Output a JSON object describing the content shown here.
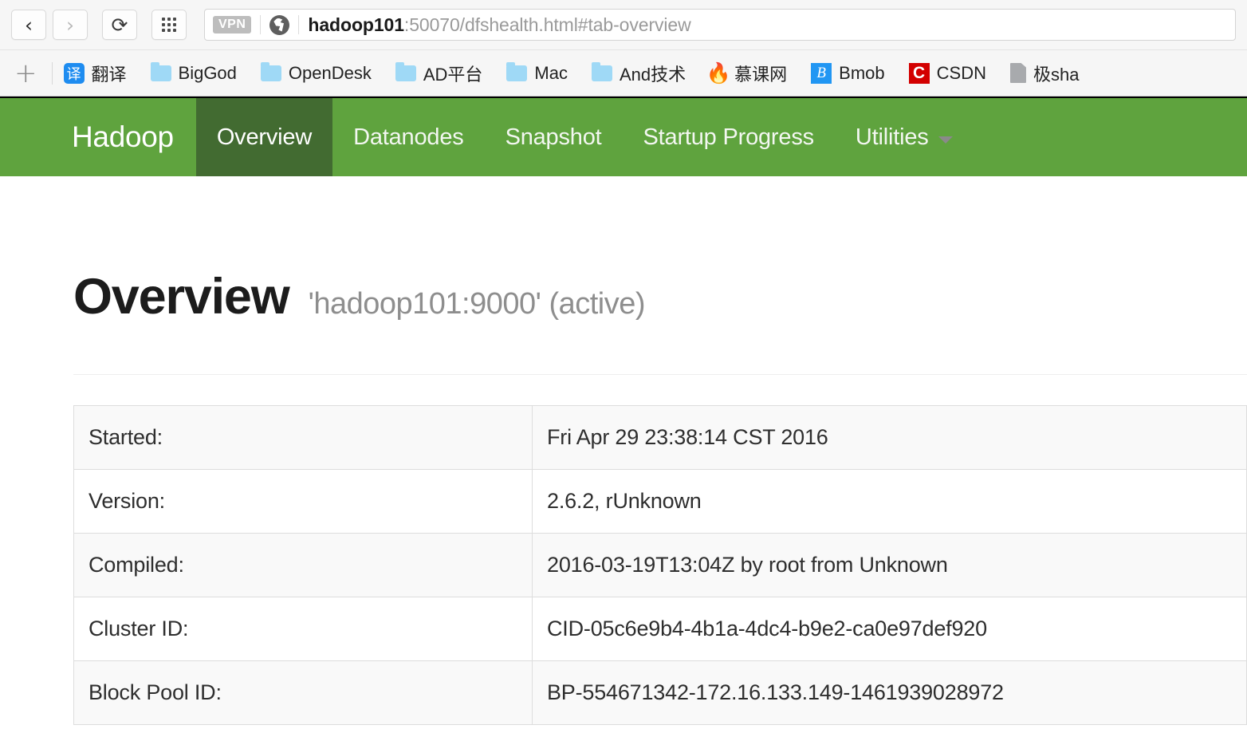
{
  "browser": {
    "back_icon": "chevron-left-icon",
    "forward_icon": "chevron-right-icon",
    "reload_icon": "reload-icon",
    "apps_icon": "apps-grid-icon",
    "vpn_badge": "VPN",
    "site_icon": "globe-icon",
    "url_host": "hadoop101",
    "url_rest": ":50070/dfshealth.html#tab-overview",
    "url_full": "hadoop101:50070/dfshealth.html#tab-overview"
  },
  "bookmarks": {
    "add_label": "+",
    "items": [
      {
        "label": "翻译",
        "icon": "translate-icon"
      },
      {
        "label": "BigGod",
        "icon": "folder-icon"
      },
      {
        "label": "OpenDesk",
        "icon": "folder-icon"
      },
      {
        "label": "AD平台",
        "icon": "folder-icon"
      },
      {
        "label": "Mac",
        "icon": "folder-icon"
      },
      {
        "label": "And技术",
        "icon": "folder-icon"
      },
      {
        "label": "慕课网",
        "icon": "flame-icon"
      },
      {
        "label": "Bmob",
        "icon": "bmob-icon"
      },
      {
        "label": "CSDN",
        "icon": "csdn-icon"
      },
      {
        "label": "极sha",
        "icon": "document-icon"
      }
    ],
    "icon_glyphs": {
      "translate": "译",
      "flame": "🔥",
      "bmob": "B",
      "csdn": "C"
    }
  },
  "navbar": {
    "brand": "Hadoop",
    "links": [
      {
        "label": "Overview",
        "active": true
      },
      {
        "label": "Datanodes",
        "active": false
      },
      {
        "label": "Snapshot",
        "active": false
      },
      {
        "label": "Startup Progress",
        "active": false
      },
      {
        "label": "Utilities",
        "active": false,
        "has_caret": true
      }
    ],
    "colors": {
      "bar": "#5fa33e",
      "active": "#426b31",
      "text": "#ffffff"
    }
  },
  "main": {
    "title": "Overview",
    "subtitle": "'hadoop101:9000' (active)",
    "table": {
      "rows": [
        {
          "key": "Started:",
          "value": "Fri Apr 29 23:38:14 CST 2016"
        },
        {
          "key": "Version:",
          "value": "2.6.2, rUnknown"
        },
        {
          "key": "Compiled:",
          "value": "2016-03-19T13:04Z by root from Unknown"
        },
        {
          "key": "Cluster ID:",
          "value": "CID-05c6e9b4-4b1a-4dc4-b9e2-ca0e97def920"
        },
        {
          "key": "Block Pool ID:",
          "value": "BP-554671342-172.16.133.149-1461939028972"
        }
      ]
    }
  }
}
